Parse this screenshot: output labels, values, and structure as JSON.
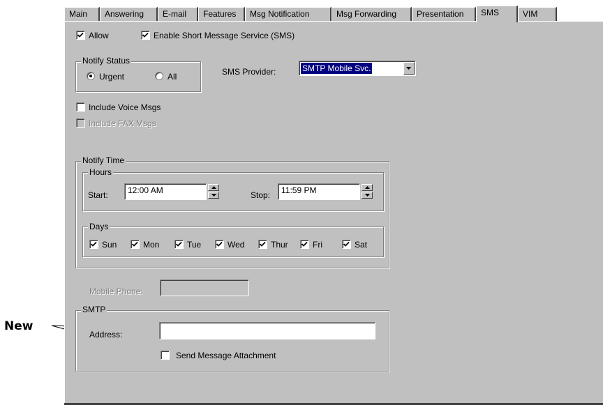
{
  "annotation": {
    "label": "New"
  },
  "tabs": [
    "Main",
    "Answering",
    "E-mail",
    "Features",
    "Msg Notification",
    "Msg Forwarding",
    "Presentation",
    "SMS",
    "VIM"
  ],
  "active_tab": "SMS",
  "allow": {
    "label": "Allow",
    "checked": true
  },
  "enable_sms": {
    "label": "Enable Short Message Service (SMS)",
    "checked": true
  },
  "notify_status": {
    "title": "Notify Status",
    "urgent": {
      "label": "Urgent",
      "selected": true
    },
    "all": {
      "label": "All",
      "selected": false
    }
  },
  "sms_provider": {
    "label": "SMS Provider:",
    "value": "SMTP Mobile Svc."
  },
  "include_voice": {
    "label": "Include Voice Msgs",
    "checked": false
  },
  "include_fax": {
    "label": "Include FAX Msgs",
    "checked": false,
    "disabled": true
  },
  "notify_time": {
    "title": "Notify Time",
    "hours": {
      "title": "Hours",
      "start_label": "Start:",
      "start_value": "12:00 AM",
      "stop_label": "Stop:",
      "stop_value": "11:59 PM"
    },
    "days": {
      "title": "Days",
      "items": [
        {
          "label": "Sun",
          "checked": true
        },
        {
          "label": "Mon",
          "checked": true
        },
        {
          "label": "Tue",
          "checked": true
        },
        {
          "label": "Wed",
          "checked": true
        },
        {
          "label": "Thur",
          "checked": true
        },
        {
          "label": "Fri",
          "checked": true
        },
        {
          "label": "Sat",
          "checked": true
        }
      ]
    }
  },
  "mobile_phone": {
    "label": "Mobile Phone:",
    "value": "",
    "disabled": true
  },
  "smtp": {
    "title": "SMTP",
    "address_label": "Address:",
    "address_value": "",
    "send_attachment": {
      "label": "Send Message Attachment",
      "checked": false
    }
  },
  "colors": {
    "panel": "#c0c0c0",
    "selection": "#000080"
  }
}
